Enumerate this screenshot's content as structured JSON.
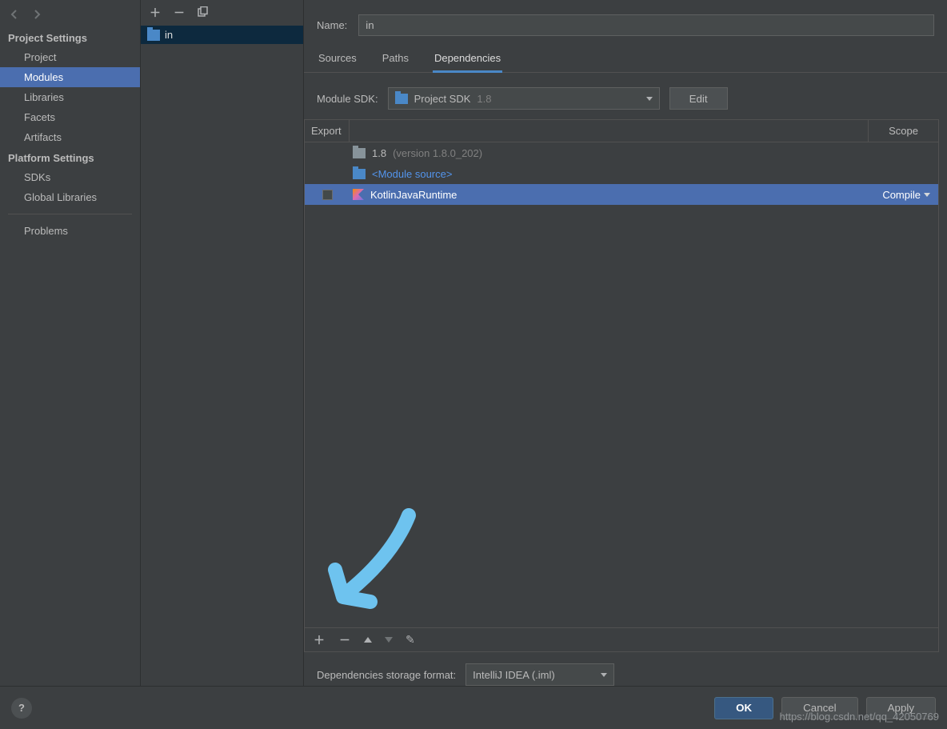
{
  "sidebar": {
    "sections": {
      "project": {
        "title": "Project Settings",
        "items": [
          "Project",
          "Modules",
          "Libraries",
          "Facets",
          "Artifacts"
        ],
        "selected": 1
      },
      "platform": {
        "title": "Platform Settings",
        "items": [
          "SDKs",
          "Global Libraries"
        ]
      },
      "problems": "Problems"
    }
  },
  "tree": {
    "module_name": "in"
  },
  "detail": {
    "name_label": "Name:",
    "name_value": "in",
    "tabs": [
      "Sources",
      "Paths",
      "Dependencies"
    ],
    "active_tab": 2,
    "sdk_label": "Module SDK:",
    "sdk_value": "Project SDK",
    "sdk_version": "1.8",
    "edit_label": "Edit",
    "table": {
      "headers": {
        "export": "Export",
        "scope": "Scope"
      },
      "rows": [
        {
          "icon": "folder-grey",
          "name": "1.8",
          "extra": "(version 1.8.0_202)"
        },
        {
          "icon": "folder-blue",
          "name": "<Module source>",
          "link": true
        },
        {
          "icon": "kotlin",
          "name": "KotlinJavaRuntime",
          "selected": true,
          "export_cb": true,
          "scope": "Compile"
        }
      ]
    },
    "storage_label": "Dependencies storage format:",
    "storage_value": "IntelliJ IDEA (.iml)"
  },
  "footer": {
    "ok": "OK",
    "cancel": "Cancel",
    "apply": "Apply"
  },
  "watermark": "https://blog.csdn.net/qq_42050769"
}
